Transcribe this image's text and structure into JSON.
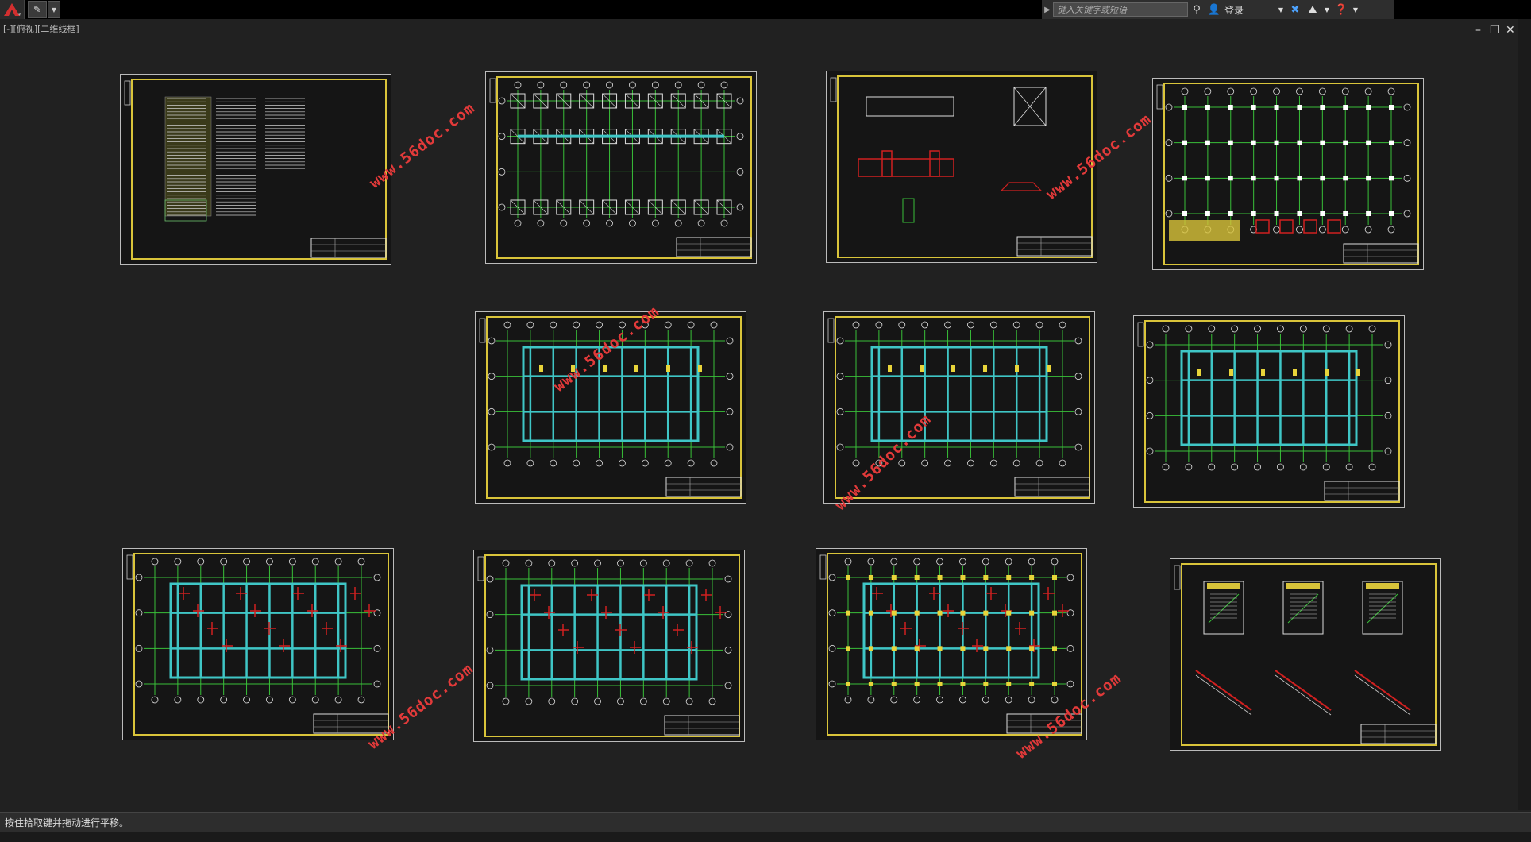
{
  "toolbar": {
    "search_placeholder": "键入关键字或短语",
    "login_label": "登录"
  },
  "view": {
    "label": "[-][俯视][二维线框]"
  },
  "status": {
    "message": "按住拾取键并拖动进行平移。"
  },
  "watermark": {
    "text": "www.56doc.com"
  },
  "colors": {
    "frame": "#d9c43a",
    "grid": "#39c039",
    "beam": "#3fc6c6",
    "rebar": "#d02020",
    "dim": "#e0e0e0"
  }
}
